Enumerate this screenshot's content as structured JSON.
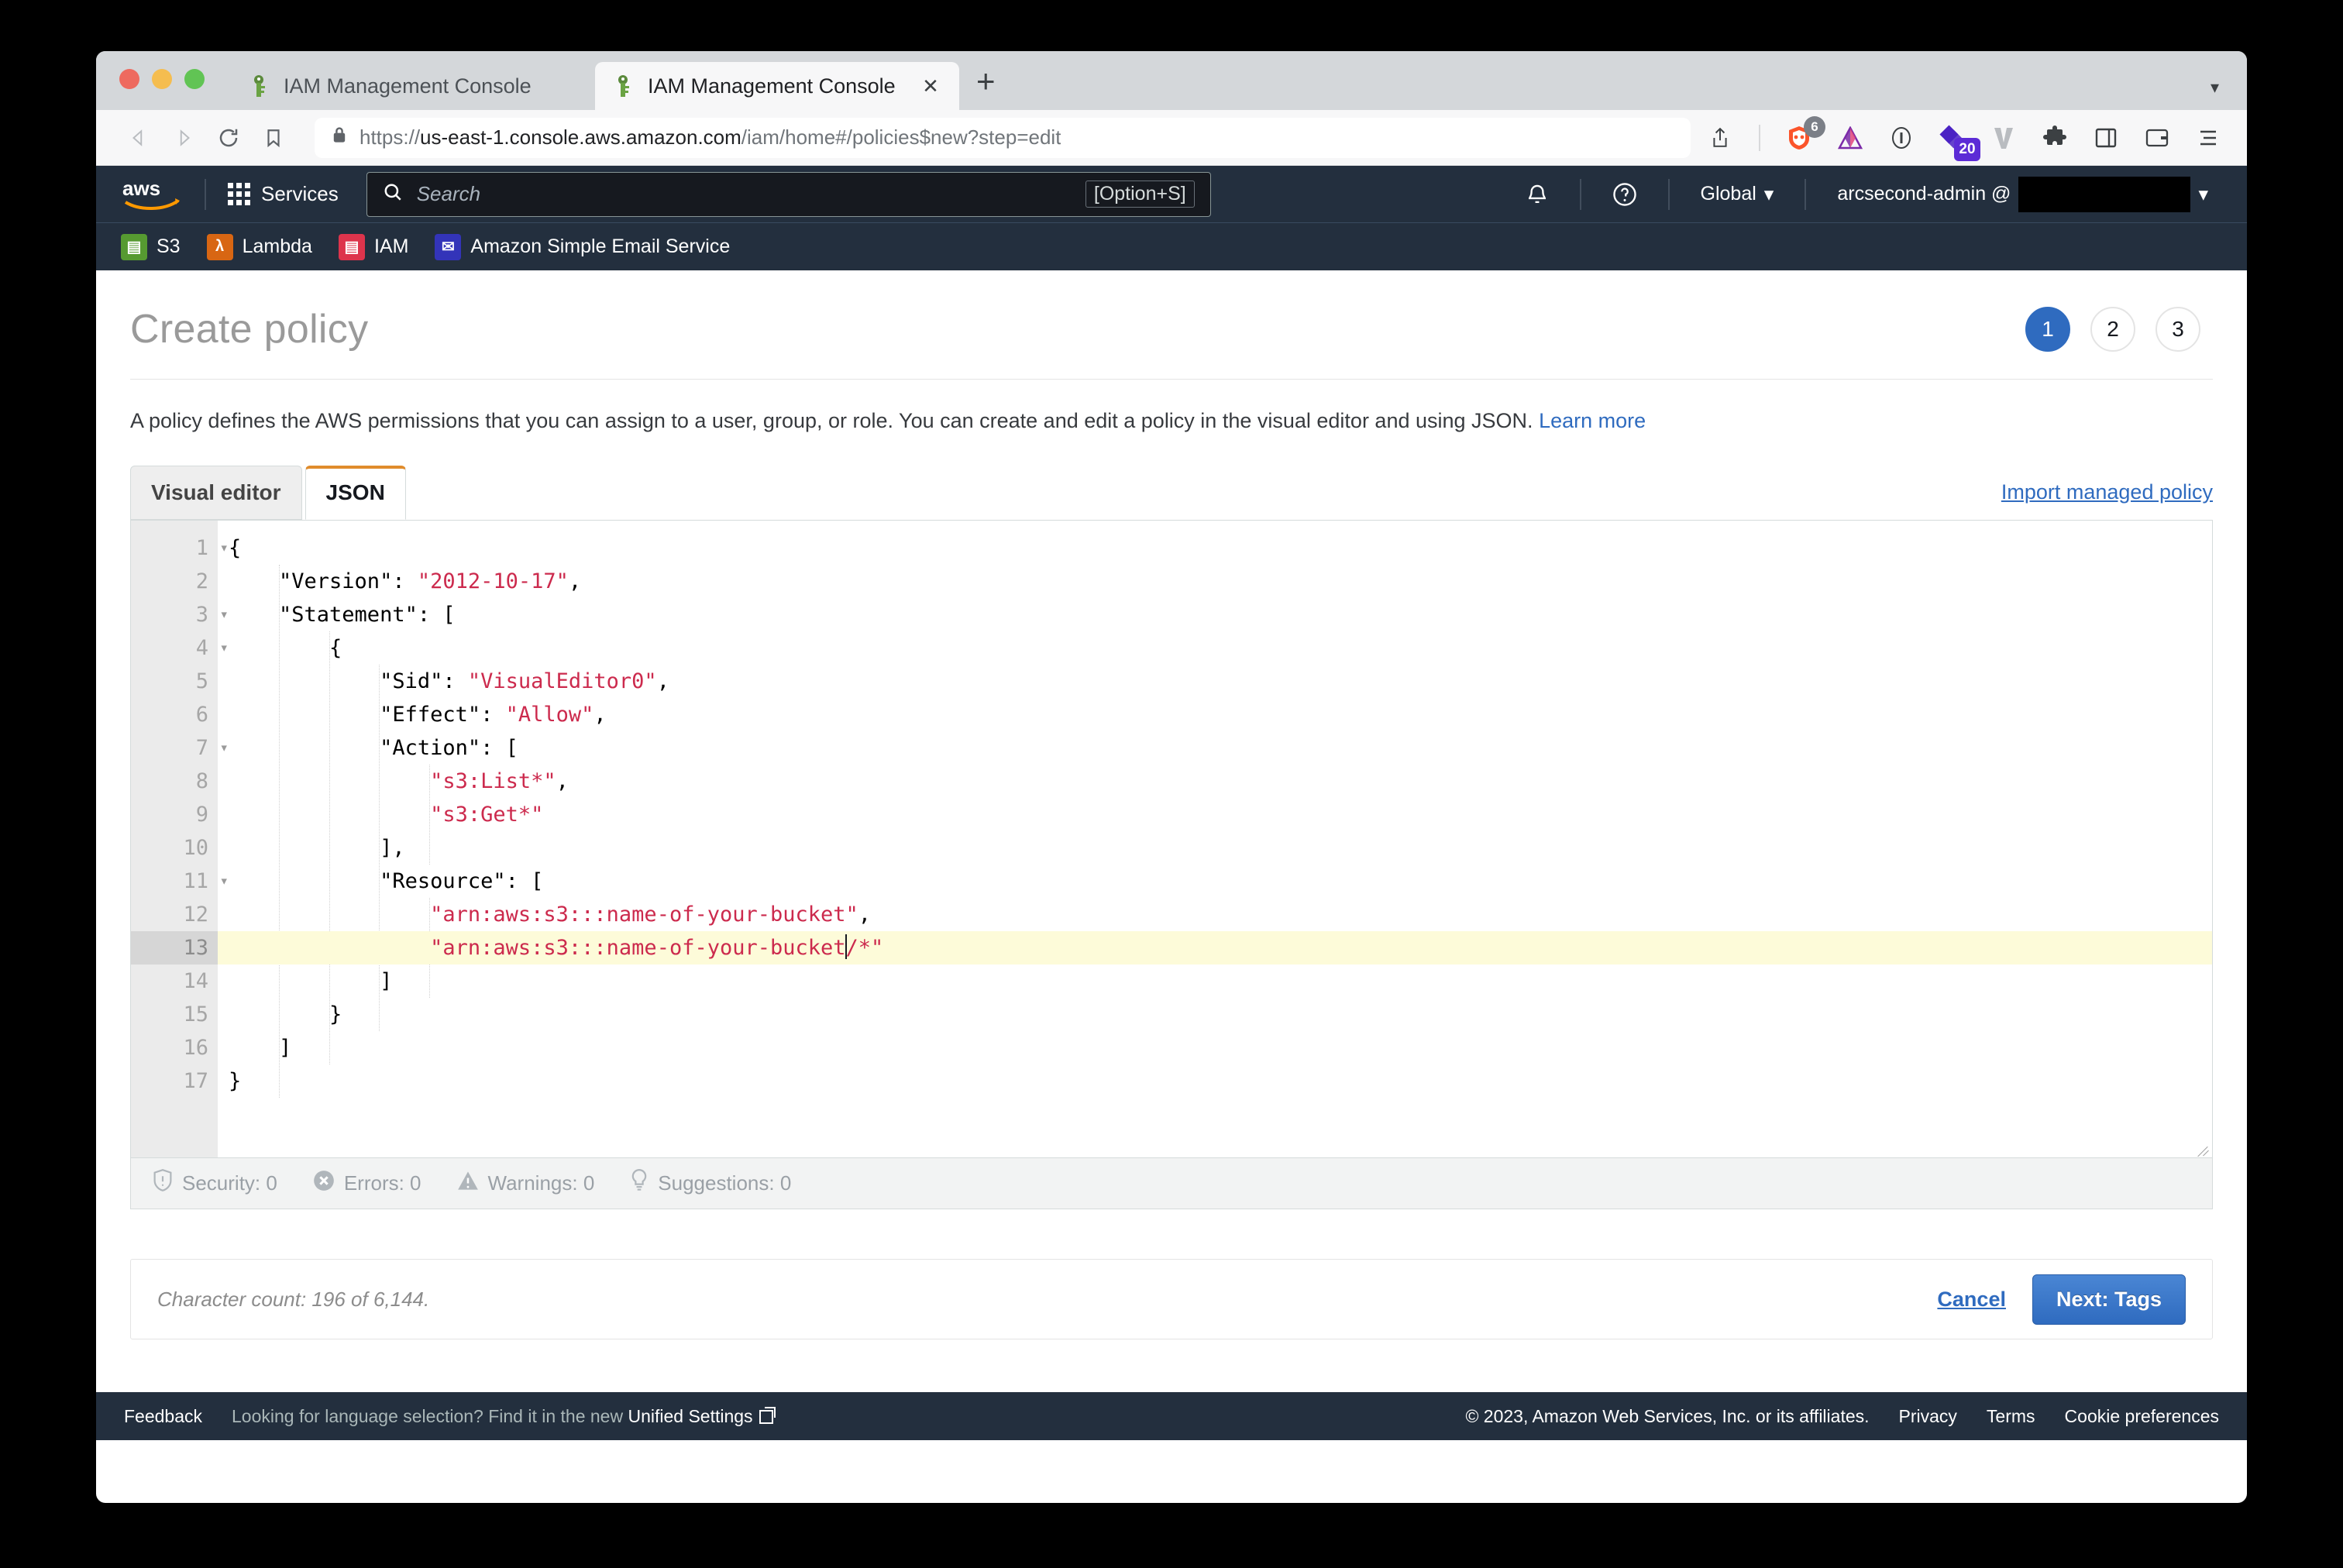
{
  "browser": {
    "tabs": [
      {
        "title": "IAM Management Console",
        "icon": "key-icon",
        "active": false
      },
      {
        "title": "IAM Management Console",
        "icon": "key-icon",
        "active": true,
        "close_label": "✕"
      }
    ],
    "new_tab_label": "+",
    "tab_list_chevron": "▾",
    "nav": {
      "back": "back-icon",
      "forward": "forward-icon",
      "reload": "reload-icon",
      "bookmark": "bookmark-icon"
    },
    "omnibox": {
      "lock": "lock-icon",
      "url_prefix": "https://",
      "url_host": "us-east-1.console.aws.amazon.com",
      "url_path": "/iam/home#/policies$new?step=edit"
    },
    "toolbar_icons": [
      {
        "name": "share-icon",
        "badge": ""
      },
      {
        "name": "brave-shields-icon",
        "badge": "6"
      },
      {
        "name": "brave-rewards-icon",
        "badge": ""
      },
      {
        "name": "bitwarden-icon",
        "badge": ""
      },
      {
        "name": "onepassword-icon",
        "badge": "20"
      },
      {
        "name": "vimium-icon",
        "badge": ""
      },
      {
        "name": "extensions-puzzle-icon",
        "badge": ""
      },
      {
        "name": "sidebar-icon",
        "badge": ""
      },
      {
        "name": "wallet-icon",
        "badge": ""
      },
      {
        "name": "menu-icon",
        "badge": ""
      }
    ]
  },
  "aws_nav": {
    "logo": "aws-logo",
    "services_label": "Services",
    "search_placeholder": "Search",
    "search_shortcut": "[Option+S]",
    "notifications_icon": "bell-icon",
    "help_icon": "question-icon",
    "region_label": "Global",
    "region_caret": "▾",
    "account_label": "arcsecond-admin @",
    "account_caret": "▾",
    "favorites": [
      {
        "label": "S3",
        "icon": "s3-icon",
        "color": "#569A31",
        "glyph": "▤"
      },
      {
        "label": "Lambda",
        "icon": "lambda-icon",
        "color": "#D86613",
        "glyph": "λ"
      },
      {
        "label": "IAM",
        "icon": "iam-icon",
        "color": "#DD344C",
        "glyph": "▤"
      },
      {
        "label": "Amazon Simple Email Service",
        "icon": "ses-icon",
        "color": "#3334B9",
        "glyph": "✉"
      }
    ]
  },
  "page": {
    "title": "Create policy",
    "steps": [
      {
        "number": "1",
        "current": true
      },
      {
        "number": "2",
        "current": false
      },
      {
        "number": "3",
        "current": false
      }
    ],
    "intro_text": "A policy defines the AWS permissions that you can assign to a user, group, or role. You can create and edit a policy in the visual editor and using JSON.",
    "learn_more_label": "Learn more",
    "tabs": [
      {
        "label": "Visual editor",
        "active": false
      },
      {
        "label": "JSON",
        "active": true
      }
    ],
    "import_link_label": "Import managed policy",
    "accent_color": "#e08c2c",
    "link_color": "#2f6bbf"
  },
  "editor": {
    "lines": [
      {
        "n": "1",
        "fold": true,
        "indent": 0,
        "segments": [
          {
            "t": "{",
            "s": "plain"
          }
        ]
      },
      {
        "n": "2",
        "fold": false,
        "indent": 1,
        "segments": [
          {
            "t": "    \"Version\": ",
            "s": "plain"
          },
          {
            "t": "\"2012-10-17\"",
            "s": "string"
          },
          {
            "t": ",",
            "s": "plain"
          }
        ]
      },
      {
        "n": "3",
        "fold": true,
        "indent": 1,
        "segments": [
          {
            "t": "    \"Statement\": [",
            "s": "plain"
          }
        ]
      },
      {
        "n": "4",
        "fold": true,
        "indent": 2,
        "segments": [
          {
            "t": "        {",
            "s": "plain"
          }
        ]
      },
      {
        "n": "5",
        "fold": false,
        "indent": 3,
        "segments": [
          {
            "t": "            \"Sid\": ",
            "s": "plain"
          },
          {
            "t": "\"VisualEditor0\"",
            "s": "string"
          },
          {
            "t": ",",
            "s": "plain"
          }
        ]
      },
      {
        "n": "6",
        "fold": false,
        "indent": 3,
        "segments": [
          {
            "t": "            \"Effect\": ",
            "s": "plain"
          },
          {
            "t": "\"Allow\"",
            "s": "string"
          },
          {
            "t": ",",
            "s": "plain"
          }
        ]
      },
      {
        "n": "7",
        "fold": true,
        "indent": 3,
        "segments": [
          {
            "t": "            \"Action\": [",
            "s": "plain"
          }
        ]
      },
      {
        "n": "8",
        "fold": false,
        "indent": 4,
        "segments": [
          {
            "t": "                ",
            "s": "plain"
          },
          {
            "t": "\"s3:List*\"",
            "s": "string"
          },
          {
            "t": ",",
            "s": "plain"
          }
        ]
      },
      {
        "n": "9",
        "fold": false,
        "indent": 4,
        "segments": [
          {
            "t": "                ",
            "s": "plain"
          },
          {
            "t": "\"s3:Get*\"",
            "s": "string"
          }
        ]
      },
      {
        "n": "10",
        "fold": false,
        "indent": 3,
        "segments": [
          {
            "t": "            ],",
            "s": "plain"
          }
        ]
      },
      {
        "n": "11",
        "fold": true,
        "indent": 3,
        "segments": [
          {
            "t": "            \"Resource\": [",
            "s": "plain"
          }
        ]
      },
      {
        "n": "12",
        "fold": false,
        "indent": 4,
        "segments": [
          {
            "t": "                ",
            "s": "plain"
          },
          {
            "t": "\"arn:aws:s3:::name-of-your-bucket\"",
            "s": "string"
          },
          {
            "t": ",",
            "s": "plain"
          }
        ]
      },
      {
        "n": "13",
        "fold": false,
        "indent": 4,
        "highlight": true,
        "segments": [
          {
            "t": "                ",
            "s": "plain"
          },
          {
            "t": "\"arn:aws:s3:::name-of-your-bucket",
            "s": "string"
          },
          {
            "t": "",
            "s": "caret"
          },
          {
            "t": "/*\"",
            "s": "string"
          }
        ]
      },
      {
        "n": "14",
        "fold": false,
        "indent": 3,
        "segments": [
          {
            "t": "            ]",
            "s": "plain"
          }
        ]
      },
      {
        "n": "15",
        "fold": false,
        "indent": 2,
        "segments": [
          {
            "t": "        }",
            "s": "plain"
          }
        ]
      },
      {
        "n": "16",
        "fold": false,
        "indent": 1,
        "segments": [
          {
            "t": "    ]",
            "s": "plain"
          }
        ]
      },
      {
        "n": "17",
        "fold": false,
        "indent": 0,
        "segments": [
          {
            "t": "}",
            "s": "plain"
          }
        ]
      }
    ],
    "status": [
      {
        "icon": "shield-icon",
        "label": "Security: 0"
      },
      {
        "icon": "error-icon",
        "label": "Errors: 0"
      },
      {
        "icon": "warning-icon",
        "label": "Warnings: 0"
      },
      {
        "icon": "bulb-icon",
        "label": "Suggestions: 0"
      }
    ]
  },
  "actions": {
    "character_count": "Character count: 196 of 6,144.",
    "cancel_label": "Cancel",
    "next_label": "Next: Tags"
  },
  "footer": {
    "feedback_label": "Feedback",
    "language_note": "Looking for language selection? Find it in the new",
    "unified_settings_label": "Unified Settings",
    "copyright": "© 2023, Amazon Web Services, Inc. or its affiliates.",
    "privacy_label": "Privacy",
    "terms_label": "Terms",
    "cookie_label": "Cookie preferences"
  }
}
